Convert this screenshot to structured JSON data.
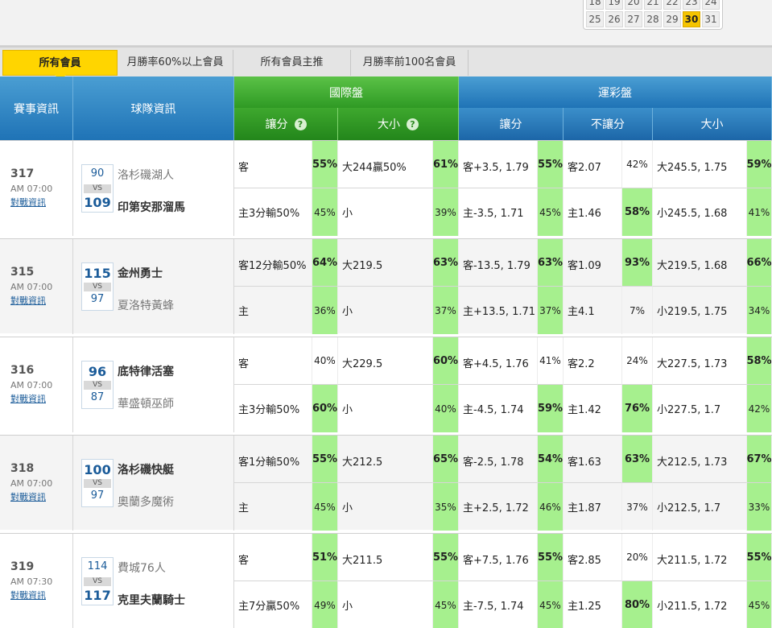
{
  "calendar": {
    "row1": [
      "18",
      "19",
      "20",
      "21",
      "22",
      "23",
      "24"
    ],
    "row2": [
      "25",
      "26",
      "27",
      "28",
      "29",
      "30",
      "31"
    ],
    "selected": "30"
  },
  "tabs": [
    "所有會員",
    "月勝率60%以上會員",
    "所有會員主推",
    "月勝率前100名會員"
  ],
  "header": {
    "event_info": "賽事資訊",
    "team_info": "球隊資訊",
    "intl": "國際盤",
    "lottery": "運彩盤",
    "intl_spread": "讓分",
    "intl_total": "大小",
    "lot_spread": "讓分",
    "lot_moneyline": "不讓分",
    "lot_total": "大小",
    "help": "?"
  },
  "games": [
    {
      "id": "317",
      "time": "AM 07:00",
      "link": "對戰資訊",
      "away_name": "洛杉磯湖人",
      "away_score": "90",
      "home_name": "印第安那溜馬",
      "home_score": "109",
      "winner": "home",
      "vs": "VS",
      "intl_spread": [
        "客",
        "主3分輸50%"
      ],
      "intl_spread_pct": [
        "55%",
        "45%"
      ],
      "intl_spread_hi": [
        0
      ],
      "intl_total": [
        "大244贏50%",
        "小"
      ],
      "intl_total_pct": [
        "61%",
        "39%"
      ],
      "intl_total_hi": [
        0
      ],
      "lot_spread": [
        "客+3.5, 1.79",
        "主-3.5, 1.71"
      ],
      "lot_spread_pct": [
        "55%",
        "45%"
      ],
      "lot_spread_hi": [
        0
      ],
      "lot_ml": [
        "客2.07",
        "主1.46"
      ],
      "lot_ml_pct": [
        "42%",
        "58%"
      ],
      "lot_ml_hi": [
        1
      ],
      "lot_total": [
        "大245.5, 1.75",
        "小245.5, 1.68"
      ],
      "lot_total_pct": [
        "59%",
        "41%"
      ],
      "lot_total_hi": [
        0
      ]
    },
    {
      "id": "315",
      "time": "AM 07:00",
      "link": "對戰資訊",
      "away_name": "金州勇士",
      "away_score": "115",
      "home_name": "夏洛特黃蜂",
      "home_score": "97",
      "winner": "away",
      "vs": "VS",
      "intl_spread": [
        "客12分輸50%",
        "主"
      ],
      "intl_spread_pct": [
        "64%",
        "36%"
      ],
      "intl_spread_hi": [
        0
      ],
      "intl_total": [
        "大219.5",
        "小"
      ],
      "intl_total_pct": [
        "63%",
        "37%"
      ],
      "intl_total_hi": [
        0
      ],
      "lot_spread": [
        "客-13.5, 1.79",
        "主+13.5, 1.71"
      ],
      "lot_spread_pct": [
        "63%",
        "37%"
      ],
      "lot_spread_hi": [
        0
      ],
      "lot_ml": [
        "客1.09",
        "主4.1"
      ],
      "lot_ml_pct": [
        "93%",
        "7%"
      ],
      "lot_ml_hi": [
        0
      ],
      "lot_total": [
        "大219.5, 1.68",
        "小219.5, 1.75"
      ],
      "lot_total_pct": [
        "66%",
        "34%"
      ],
      "lot_total_hi": [
        0
      ]
    },
    {
      "id": "316",
      "time": "AM 07:00",
      "link": "對戰資訊",
      "away_name": "底特律活塞",
      "away_score": "96",
      "home_name": "華盛頓巫師",
      "home_score": "87",
      "winner": "away",
      "vs": "VS",
      "intl_spread": [
        "客",
        "主3分輸50%"
      ],
      "intl_spread_pct": [
        "40%",
        "60%"
      ],
      "intl_spread_hi": [
        1
      ],
      "intl_total": [
        "大229.5",
        "小"
      ],
      "intl_total_pct": [
        "60%",
        "40%"
      ],
      "intl_total_hi": [
        0
      ],
      "lot_spread": [
        "客+4.5, 1.76",
        "主-4.5, 1.74"
      ],
      "lot_spread_pct": [
        "41%",
        "59%"
      ],
      "lot_spread_hi": [
        1
      ],
      "lot_ml": [
        "客2.2",
        "主1.42"
      ],
      "lot_ml_pct": [
        "24%",
        "76%"
      ],
      "lot_ml_hi": [
        1
      ],
      "lot_total": [
        "大227.5, 1.73",
        "小227.5, 1.7"
      ],
      "lot_total_pct": [
        "58%",
        "42%"
      ],
      "lot_total_hi": [
        0
      ]
    },
    {
      "id": "318",
      "time": "AM 07:00",
      "link": "對戰資訊",
      "away_name": "洛杉磯快艇",
      "away_score": "100",
      "home_name": "奧蘭多魔術",
      "home_score": "97",
      "winner": "away",
      "vs": "VS",
      "intl_spread": [
        "客1分輸50%",
        "主"
      ],
      "intl_spread_pct": [
        "55%",
        "45%"
      ],
      "intl_spread_hi": [
        0
      ],
      "intl_total": [
        "大212.5",
        "小"
      ],
      "intl_total_pct": [
        "65%",
        "35%"
      ],
      "intl_total_hi": [
        0
      ],
      "lot_spread": [
        "客-2.5, 1.78",
        "主+2.5, 1.72"
      ],
      "lot_spread_pct": [
        "54%",
        "46%"
      ],
      "lot_spread_hi": [
        0
      ],
      "lot_ml": [
        "客1.63",
        "主1.87"
      ],
      "lot_ml_pct": [
        "63%",
        "37%"
      ],
      "lot_ml_hi": [
        0
      ],
      "lot_total": [
        "大212.5, 1.73",
        "小212.5, 1.7"
      ],
      "lot_total_pct": [
        "67%",
        "33%"
      ],
      "lot_total_hi": [
        0
      ]
    },
    {
      "id": "319",
      "time": "AM 07:30",
      "link": "對戰資訊",
      "away_name": "費城76人",
      "away_score": "114",
      "home_name": "克里夫蘭騎士",
      "home_score": "117",
      "winner": "home",
      "vs": "VS",
      "intl_spread": [
        "客",
        "主7分贏50%"
      ],
      "intl_spread_pct": [
        "51%",
        "49%"
      ],
      "intl_spread_hi": [
        0
      ],
      "intl_total": [
        "大211.5",
        "小"
      ],
      "intl_total_pct": [
        "55%",
        "45%"
      ],
      "intl_total_hi": [
        0
      ],
      "lot_spread": [
        "客+7.5, 1.76",
        "主-7.5, 1.74"
      ],
      "lot_spread_pct": [
        "55%",
        "45%"
      ],
      "lot_spread_hi": [
        0
      ],
      "lot_ml": [
        "客2.85",
        "主1.25"
      ],
      "lot_ml_pct": [
        "20%",
        "80%"
      ],
      "lot_ml_hi": [
        1
      ],
      "lot_total": [
        "大211.5, 1.72",
        "小211.5, 1.72"
      ],
      "lot_total_pct": [
        "55%",
        "45%"
      ],
      "lot_total_hi": [
        0
      ]
    }
  ]
}
